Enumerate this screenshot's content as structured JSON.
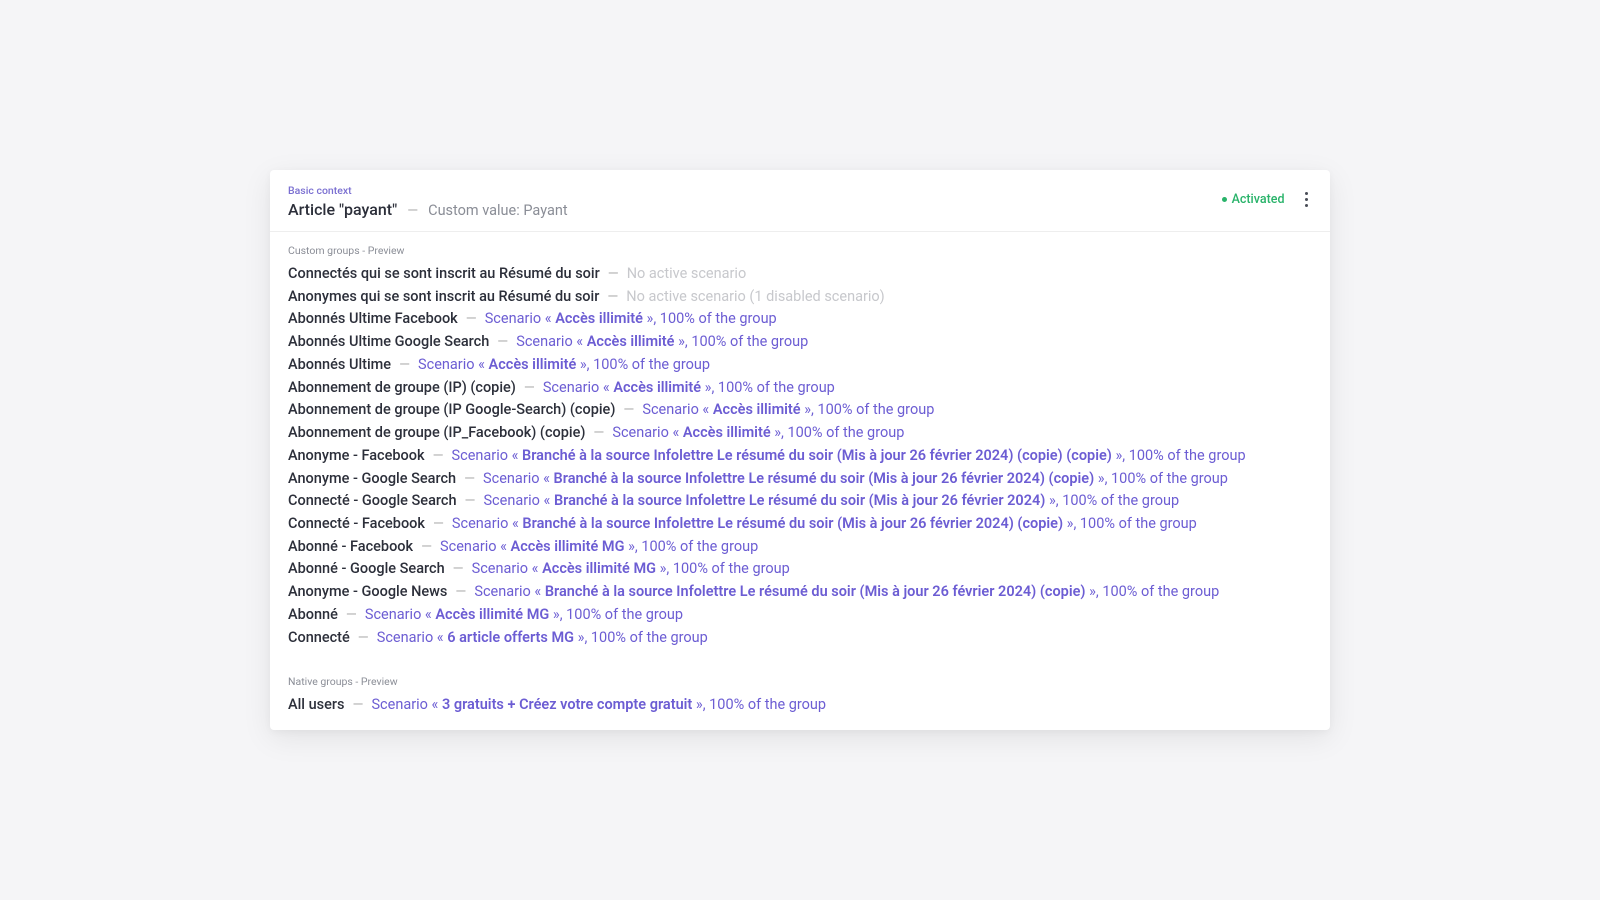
{
  "header": {
    "basicContext": "Basic context",
    "title": "Article \"payant\"",
    "customValueLabel": "Custom value: Payant",
    "status": "Activated"
  },
  "sections": {
    "custom": "Custom groups - Preview",
    "native": "Native groups - Preview"
  },
  "dashChar": "—",
  "customGroups": [
    {
      "name": "Connectés qui se sont inscrit au Résumé du soir",
      "inactive": true,
      "text": "No active scenario"
    },
    {
      "name": "Anonymes qui se sont inscrit au Résumé du soir",
      "inactive": true,
      "text": "No active scenario (1 disabled scenario)"
    },
    {
      "name": "Abonnés Ultime Facebook",
      "scenario": "Accès illimité",
      "pct": "100% of the group"
    },
    {
      "name": "Abonnés Ultime Google Search",
      "scenario": "Accès illimité",
      "pct": "100% of the group"
    },
    {
      "name": "Abonnés Ultime",
      "scenario": "Accès illimité",
      "pct": "100% of the group"
    },
    {
      "name": "Abonnement de groupe (IP) (copie)",
      "scenario": "Accès illimité",
      "pct": "100% of the group"
    },
    {
      "name": "Abonnement de groupe (IP Google-Search) (copie)",
      "scenario": "Accès illimité",
      "pct": "100% of the group"
    },
    {
      "name": "Abonnement de groupe (IP_Facebook) (copie)",
      "scenario": "Accès illimité",
      "pct": "100% of the group"
    },
    {
      "name": "Anonyme - Facebook",
      "scenario": "Branché à la source Infolettre Le résumé du soir (Mis à jour 26 février 2024) (copie) (copie)",
      "pct": "100% of the group"
    },
    {
      "name": "Anonyme - Google Search",
      "scenario": "Branché à la source Infolettre Le résumé du soir (Mis à jour 26 février 2024) (copie)",
      "pct": "100% of the group"
    },
    {
      "name": "Connecté - Google Search",
      "scenario": "Branché à la source Infolettre Le résumé du soir (Mis à jour 26 février 2024)",
      "pct": "100% of the group"
    },
    {
      "name": "Connecté - Facebook",
      "scenario": "Branché à la source Infolettre Le résumé du soir (Mis à jour 26 février 2024) (copie)",
      "pct": "100% of the group"
    },
    {
      "name": "Abonné - Facebook",
      "scenario": "Accès illimité MG",
      "pct": "100% of the group"
    },
    {
      "name": "Abonné - Google Search",
      "scenario": "Accès illimité MG",
      "pct": "100% of the group"
    },
    {
      "name": "Anonyme - Google News",
      "scenario": "Branché à la source Infolettre Le résumé du soir (Mis à jour 26 février 2024) (copie)",
      "pct": "100% of the group"
    },
    {
      "name": "Abonné",
      "scenario": "Accès illimité MG",
      "pct": "100% of the group"
    },
    {
      "name": "Connecté",
      "scenario": "6 article offerts MG",
      "pct": "100% of the group"
    }
  ],
  "nativeGroups": [
    {
      "name": "All users",
      "scenario": "3 gratuits + Créez votre compte gratuit",
      "pct": "100% of the group"
    }
  ],
  "scenarioWrap": {
    "prefix": "Scenario « ",
    "suffix": " »,"
  }
}
